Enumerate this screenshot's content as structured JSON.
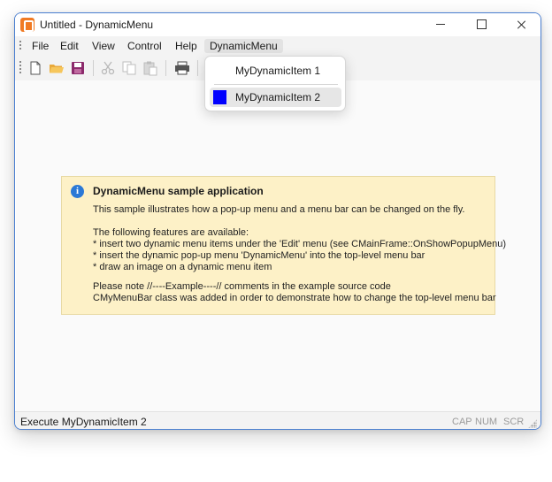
{
  "window": {
    "title": "Untitled - DynamicMenu",
    "accent": "#4a7fd0"
  },
  "menubar": {
    "items": [
      {
        "label": "File"
      },
      {
        "label": "Edit"
      },
      {
        "label": "View"
      },
      {
        "label": "Control"
      },
      {
        "label": "Help"
      },
      {
        "label": "DynamicMenu",
        "active": true
      }
    ]
  },
  "toolbar": {
    "buttons": [
      {
        "icon": "new-document-icon",
        "enabled": true
      },
      {
        "icon": "open-folder-icon",
        "enabled": true
      },
      {
        "icon": "save-disk-icon",
        "enabled": true
      },
      {
        "icon": "cut-scissors-icon",
        "enabled": false
      },
      {
        "icon": "copy-icon",
        "enabled": false
      },
      {
        "icon": "paste-icon",
        "enabled": false
      },
      {
        "icon": "print-icon",
        "enabled": true
      }
    ]
  },
  "popup": {
    "items": [
      {
        "label": "MyDynamicItem 1"
      },
      {
        "label": "MyDynamicItem 2",
        "highlighted": true,
        "swatch_color": "#0000ff"
      }
    ]
  },
  "info": {
    "title": "DynamicMenu sample application",
    "lines": [
      "This sample illustrates how a pop-up menu and a menu bar can be changed on the fly.",
      "The following features are available:",
      "* insert two dynamic menu items under the 'Edit' menu (see CMainFrame::OnShowPopupMenu)",
      "* insert the dynamic pop-up menu 'DynamicMenu' into the top-level menu bar",
      "* draw an image on a dynamic menu item",
      "Please note //----Example----// comments in the example source code",
      "CMyMenuBar class was added in order to demonstrate how to change the top-level menu bar"
    ],
    "background": "#fdf1c7"
  },
  "status": {
    "text": "Execute MyDynamicItem 2",
    "indicators": [
      "CAP",
      "NUM",
      "SCR"
    ]
  }
}
